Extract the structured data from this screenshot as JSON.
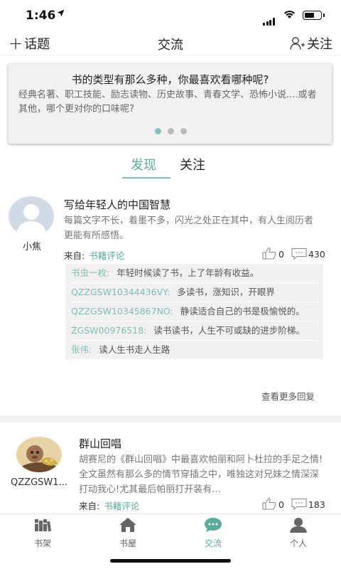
{
  "status_bar": {
    "time": "1:46"
  },
  "nav": {
    "left_label": "话题",
    "title": "交流",
    "right_label": "关注"
  },
  "banner": {
    "title": "书的类型有那么多种，你最喜欢看哪种呢?",
    "text": "经典名著、职工技能、励志读物、历史故事、青春文学、恐怖小说....或者其他，哪个更对你的口味呢?",
    "page_count": 3,
    "active_page": 1
  },
  "tabs": [
    {
      "label": "发现"
    },
    {
      "label": "关注"
    }
  ],
  "posts": [
    {
      "user": "小焦",
      "title": "写给年轻人的中国智慧",
      "body": "每篇文字不长，着墨不多，闪光之处正在其中，有人生阅历者更能有所感悟。",
      "source_label": "来自:",
      "source_link": "书籍评论",
      "likes": "0",
      "comments": "430",
      "replies": [
        {
          "name": "书虫一枚:",
          "text": "年轻时候读了书，上了年龄有收益。"
        },
        {
          "name": "QZZGSW10344436VY:",
          "text": "多读书，涨知识，开眼界"
        },
        {
          "name": "QZZGSW10345867NO:",
          "text": "静读适合自己的书是极愉悦的。"
        },
        {
          "name": "ZGSW00976518:",
          "text": "读书读书，人生不可或缺的进步阶梯。"
        },
        {
          "name": "张伟:",
          "text": "读人生书走人生路"
        }
      ],
      "more_label": "查看更多回复"
    },
    {
      "user": "QZZGSW1...",
      "title": "群山回唱",
      "body": "胡赛尼的《群山回唱》中最喜欢帕丽和阿卜杜拉的手足之情!全文虽然有那么多的情节穿插之中，唯独这对兄妹之情深深打动我心!尤其最后帕丽打开装有...",
      "source_label": "来自:",
      "source_link": "书籍评论",
      "likes": "0",
      "comments": "183"
    }
  ],
  "tabbar": [
    {
      "label": "书架",
      "icon": "bookshelf-icon"
    },
    {
      "label": "书屋",
      "icon": "home-icon"
    },
    {
      "label": "交流",
      "icon": "chat-icon"
    },
    {
      "label": "个人",
      "icon": "person-icon"
    }
  ],
  "colors": {
    "accent": "#5aab9c",
    "reply_name": "#7fbdb2",
    "banner_bg": "#f2f2f2"
  }
}
